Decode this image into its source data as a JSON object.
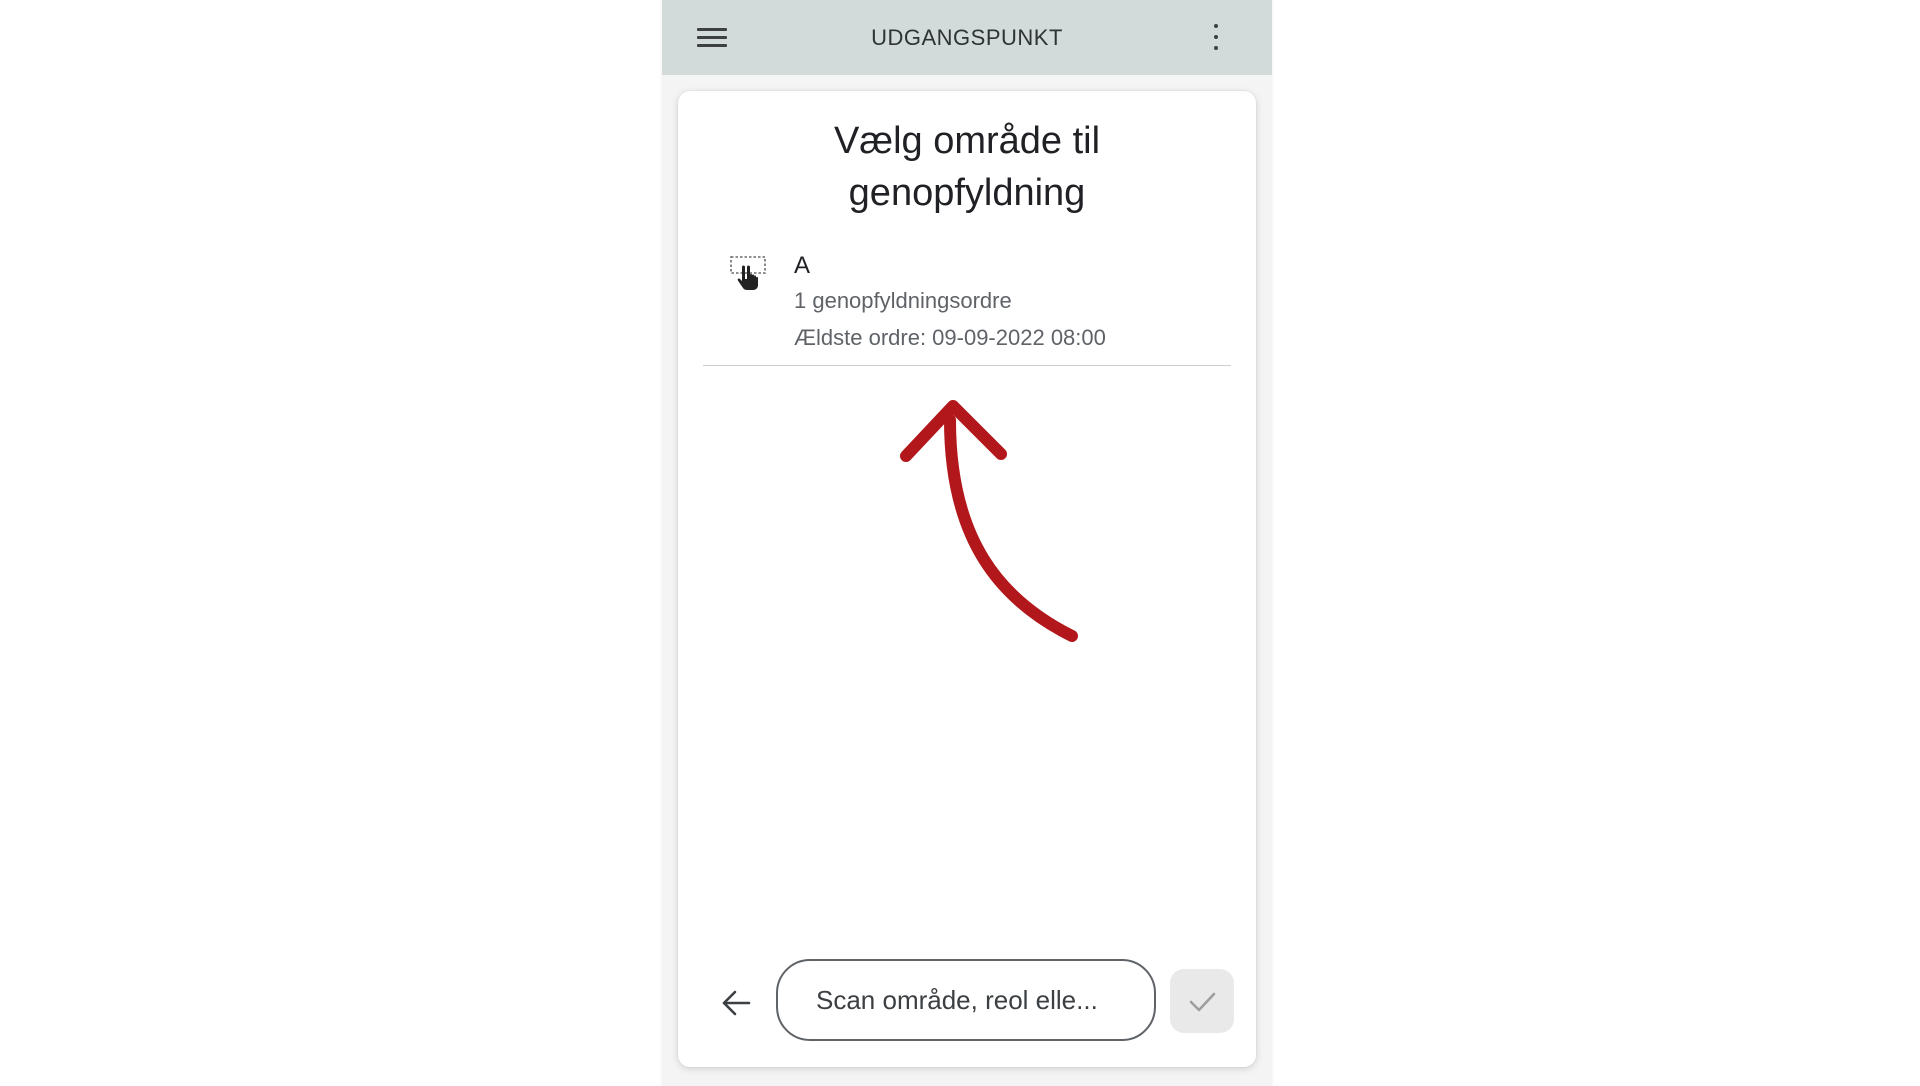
{
  "appbar": {
    "title": "UDGANGSPUNKT",
    "menu_icon": "hamburger-menu-icon",
    "more_icon": "more-vertical-icon",
    "background": "#d3dbda"
  },
  "card": {
    "title": "Vælg område til genopfyldning"
  },
  "area_list": [
    {
      "name": "A",
      "order_count_text": "1 genopfyldningsordre",
      "oldest_order_text": "Ældste ordre: 09-09-2022 08:00",
      "icon": "select-area-hand-icon"
    }
  ],
  "annotation": {
    "icon": "curved-arrow-pointer",
    "color": "#b2171b"
  },
  "footer": {
    "back_icon": "arrow-left-icon",
    "scan_placeholder": "Scan område, reol elle...",
    "confirm_icon": "checkmark-icon"
  }
}
